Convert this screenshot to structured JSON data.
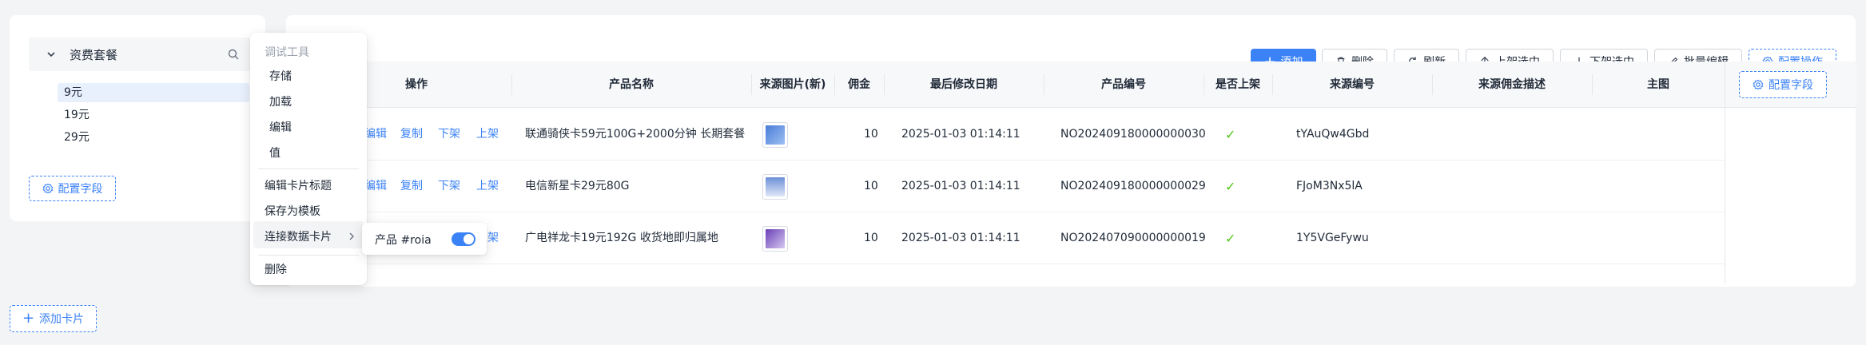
{
  "left_panel": {
    "category_title": "资费套餐",
    "items": [
      "9元",
      "19元",
      "29元"
    ],
    "config_fields_label": "配置字段"
  },
  "add_card_label": "添加卡片",
  "toolbar": {
    "add": "添加",
    "delete": "删除",
    "refresh": "刷新",
    "list_selected": "上架选中",
    "unlist_selected": "下架选中",
    "batch_edit": "批量编辑",
    "config_actions": "配置操作"
  },
  "table": {
    "headers": {
      "actions": "操作",
      "name": "产品名称",
      "image": "来源图片(新)",
      "commission": "佣金",
      "modified": "最后修改日期",
      "code": "产品编号",
      "listed": "是否上架",
      "source_code": "来源编号",
      "source_desc": "来源佣金描述",
      "main_image": "主图"
    },
    "config_fields_label": "配置字段",
    "row_actions": {
      "edit": "编辑",
      "copy": "复制",
      "unlist": "下架",
      "list": "上架"
    },
    "rows": [
      {
        "name": "联通骑侠卡59元100G+2000分钟 长期套餐",
        "commission": "10",
        "modified": "2025-01-03 01:14:11",
        "code": "NO202409180000000030",
        "listed": "✓",
        "source_code": "tYAuQw4Gbd",
        "thumb_color": "#4a7bd8"
      },
      {
        "name": "电信新星卡29元80G",
        "commission": "10",
        "modified": "2025-01-03 01:14:11",
        "code": "NO202409180000000029",
        "listed": "✓",
        "source_code": "FJoM3Nx5lA",
        "thumb_color": "#6b8fd6"
      },
      {
        "name": "广电祥龙卡19元192G 收货地即归属地",
        "commission": "10",
        "modified": "2025-01-03 01:14:11",
        "code": "NO202407090000000019",
        "listed": "✓",
        "source_code": "1Y5VGeFywu",
        "thumb_color": "#6a3fb8"
      }
    ]
  },
  "context_menu": {
    "group_label": "调试工具",
    "debug_items": [
      "存储",
      "加载",
      "编辑",
      "值"
    ],
    "edit_card_title": "编辑卡片标题",
    "save_as_template": "保存为模板",
    "connect_data_card": "连接数据卡片",
    "delete": "删除"
  },
  "submenu": {
    "item_label": "产品 #roia",
    "toggle_on": true
  },
  "colors": {
    "accent": "#3b82f6",
    "check": "#52c41a"
  }
}
